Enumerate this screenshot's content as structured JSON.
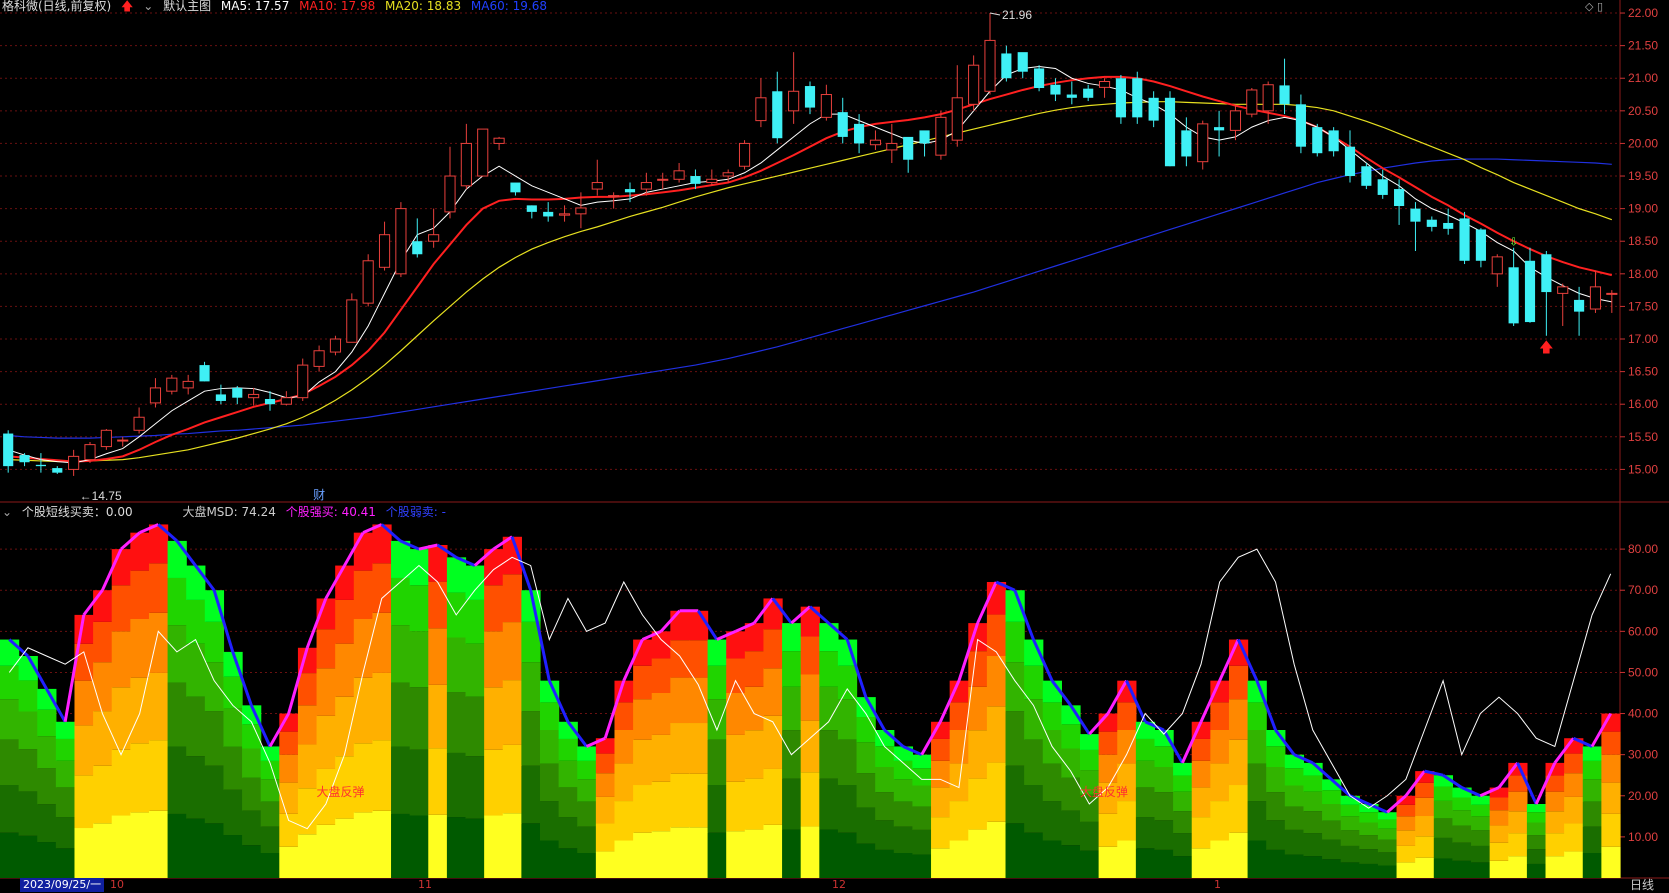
{
  "main_header": {
    "stock": "格科微(日线,前复权)",
    "template": "默认主图",
    "ma5": "MA5: 17.57",
    "ma10": "MA10: 17.98",
    "ma20": "MA20: 18.83",
    "ma60": "MA60: 19.68"
  },
  "sub_header": {
    "indicator": "个股短线买卖：0.00",
    "msd": "大盘MSD: 74.24",
    "strong_buy": "个股强买: 40.41",
    "strong_sell": "个股弱卖: -"
  },
  "annotations": {
    "high_label": "21.96",
    "low_label": "14.75",
    "finance_mark": "财",
    "rebound_1": "大盘反弹",
    "rebound_2": "大盘反弹"
  },
  "bottom_axis": {
    "date_box": "2023/09/25/一",
    "month_0": "10",
    "month_1": "11",
    "month_2": "12",
    "month_3": "1",
    "period_button": "日线"
  },
  "colors": {
    "up": "#e8403c",
    "down": "#3ff0f5",
    "ma5": "#ffffff",
    "ma10": "#ff2020",
    "ma20": "#e6e020",
    "ma60": "#2030e0",
    "grid": "#6a1010",
    "buy_line": "#ff20ff",
    "sell_line": "#2020ff"
  },
  "chart_data": [
    {
      "type": "candlestick",
      "title": "格科微(日线,前复权)",
      "ylim": [
        14.5,
        22.2
      ],
      "y_ticks": [
        "22.00",
        "21.50",
        "21.00",
        "20.50",
        "20.00",
        "19.50",
        "19.00",
        "18.50",
        "18.00",
        "17.50",
        "17.00",
        "16.50",
        "16.00",
        "15.50",
        "15.00"
      ],
      "open": [
        15.55,
        15.22,
        15.07,
        15.02,
        15.0,
        15.15,
        15.35,
        15.45,
        15.6,
        16.02,
        16.2,
        16.25,
        16.6,
        16.15,
        16.25,
        16.1,
        16.08,
        16.0,
        16.1,
        16.58,
        16.8,
        16.95,
        17.55,
        18.1,
        18.0,
        18.5,
        18.5,
        18.95,
        19.35,
        19.5,
        20.0,
        19.4,
        19.05,
        18.95,
        18.9,
        18.92,
        19.3,
        19.2,
        19.3,
        19.3,
        19.45,
        19.45,
        19.5,
        19.4,
        19.5,
        19.65,
        20.35,
        20.8,
        20.5,
        20.88,
        20.4,
        20.48,
        20.3,
        19.98,
        19.9,
        20.1,
        20.2,
        19.82,
        20.05,
        20.6,
        20.8,
        21.38,
        21.4,
        21.15,
        20.9,
        20.75,
        20.84,
        20.86,
        21.0,
        21.0,
        20.7,
        20.7,
        20.2,
        19.72,
        20.25,
        20.2,
        20.45,
        20.5,
        20.89,
        20.6,
        20.25,
        20.2,
        19.95,
        19.65,
        19.45,
        19.3,
        19.0,
        18.83,
        18.78,
        18.85,
        18.68,
        18.0,
        18.1,
        18.2,
        18.3,
        17.7,
        17.6,
        17.46,
        17.7
      ],
      "close": [
        15.05,
        15.11,
        15.05,
        14.95,
        15.2,
        15.38,
        15.6,
        15.45,
        15.8,
        16.25,
        16.4,
        16.35,
        16.35,
        16.05,
        16.1,
        16.15,
        16.0,
        16.1,
        16.6,
        16.82,
        17.0,
        17.6,
        18.2,
        18.6,
        19.0,
        18.3,
        18.6,
        19.5,
        20.0,
        20.22,
        20.08,
        19.25,
        18.95,
        18.88,
        18.92,
        19.01,
        19.4,
        19.2,
        19.25,
        19.4,
        19.45,
        19.58,
        19.38,
        19.45,
        19.55,
        20.0,
        20.7,
        20.08,
        20.8,
        20.55,
        20.75,
        20.1,
        20.0,
        20.05,
        20.0,
        19.75,
        20.0,
        20.4,
        20.7,
        21.2,
        21.58,
        21.0,
        21.1,
        20.85,
        20.75,
        20.7,
        20.7,
        20.95,
        20.4,
        20.4,
        20.35,
        19.65,
        19.8,
        20.3,
        20.2,
        20.5,
        20.82,
        20.9,
        20.6,
        19.95,
        19.85,
        19.88,
        19.5,
        19.35,
        19.21,
        19.04,
        18.8,
        18.72,
        18.69,
        18.2,
        18.2,
        18.26,
        17.24,
        17.26,
        17.72,
        17.8,
        17.42,
        17.8,
        17.7
      ],
      "high": [
        15.6,
        15.25,
        15.25,
        15.05,
        15.3,
        15.42,
        15.62,
        15.5,
        15.95,
        16.4,
        16.45,
        16.45,
        16.65,
        16.3,
        16.28,
        16.25,
        16.2,
        16.2,
        16.7,
        16.9,
        17.05,
        17.7,
        18.3,
        18.8,
        19.1,
        18.85,
        19.0,
        19.95,
        20.3,
        20.1,
        20.1,
        19.35,
        19.05,
        19.1,
        19.05,
        19.25,
        19.75,
        19.25,
        19.4,
        19.55,
        19.55,
        19.7,
        19.6,
        19.6,
        19.6,
        20.05,
        21.0,
        21.1,
        21.4,
        20.95,
        20.9,
        20.7,
        20.45,
        20.2,
        20.3,
        20.05,
        20.05,
        20.5,
        21.2,
        21.35,
        22.0,
        21.5,
        21.35,
        21.2,
        21.0,
        20.95,
        20.9,
        21.0,
        21.05,
        21.1,
        20.8,
        20.8,
        20.4,
        20.35,
        20.5,
        20.6,
        20.85,
        20.95,
        21.3,
        20.75,
        20.3,
        20.25,
        20.2,
        19.7,
        19.6,
        19.45,
        19.1,
        18.88,
        19.0,
        18.95,
        18.7,
        18.3,
        18.4,
        18.4,
        18.35,
        17.85,
        17.8,
        18.05,
        17.75
      ],
      "low": [
        14.95,
        15.05,
        14.95,
        14.93,
        14.9,
        15.1,
        15.3,
        15.35,
        15.55,
        15.95,
        16.15,
        16.15,
        16.35,
        16.0,
        16.0,
        15.98,
        15.9,
        15.98,
        16.05,
        16.5,
        16.75,
        16.95,
        17.5,
        18.05,
        17.95,
        18.25,
        18.4,
        18.85,
        19.3,
        19.8,
        19.9,
        19.2,
        18.85,
        18.8,
        18.8,
        18.7,
        19.2,
        19.0,
        19.1,
        19.2,
        19.3,
        19.4,
        19.3,
        19.35,
        19.4,
        19.6,
        20.25,
        20.0,
        20.3,
        20.45,
        20.35,
        20.0,
        19.85,
        19.9,
        19.7,
        19.55,
        19.8,
        19.75,
        19.95,
        20.5,
        20.75,
        20.95,
        21.0,
        20.8,
        20.65,
        20.6,
        20.65,
        20.7,
        20.3,
        20.3,
        20.25,
        19.65,
        19.65,
        19.6,
        19.8,
        20.05,
        20.4,
        20.3,
        20.45,
        19.85,
        19.8,
        19.8,
        19.4,
        19.3,
        19.15,
        18.75,
        18.35,
        18.65,
        18.6,
        18.15,
        18.1,
        17.8,
        17.2,
        17.25,
        17.05,
        17.2,
        17.05,
        17.4,
        17.4
      ],
      "ma5": [
        15.3,
        15.22,
        15.15,
        15.12,
        15.1,
        15.15,
        15.24,
        15.32,
        15.5,
        15.7,
        15.9,
        16.05,
        16.2,
        16.24,
        16.25,
        16.24,
        16.18,
        16.1,
        16.12,
        16.34,
        16.5,
        16.8,
        17.2,
        17.7,
        18.2,
        18.6,
        18.7,
        18.95,
        19.3,
        19.5,
        19.65,
        19.5,
        19.35,
        19.25,
        19.15,
        19.05,
        19.1,
        19.12,
        19.15,
        19.25,
        19.3,
        19.35,
        19.4,
        19.42,
        19.45,
        19.55,
        19.7,
        19.9,
        20.1,
        20.3,
        20.45,
        20.45,
        20.35,
        20.25,
        20.15,
        20.05,
        20.0,
        20.05,
        20.2,
        20.5,
        20.8,
        21.05,
        21.15,
        21.18,
        21.15,
        21.0,
        20.92,
        20.88,
        20.82,
        20.7,
        20.6,
        20.45,
        20.25,
        20.1,
        20.05,
        20.1,
        20.25,
        20.35,
        20.4,
        20.35,
        20.25,
        20.1,
        19.9,
        19.7,
        19.5,
        19.35,
        19.15,
        19.0,
        18.9,
        18.78,
        18.65,
        18.48,
        18.35,
        18.1,
        17.95,
        17.82,
        17.7,
        17.62,
        17.57
      ],
      "ma10": [
        15.2,
        15.18,
        15.16,
        15.14,
        15.12,
        15.13,
        15.16,
        15.2,
        15.3,
        15.42,
        15.53,
        15.62,
        15.72,
        15.8,
        15.88,
        15.96,
        16.02,
        16.08,
        16.15,
        16.28,
        16.42,
        16.6,
        16.82,
        17.1,
        17.45,
        17.8,
        18.15,
        18.45,
        18.75,
        19.0,
        19.12,
        19.15,
        19.14,
        19.14,
        19.15,
        19.17,
        19.18,
        19.18,
        19.2,
        19.22,
        19.25,
        19.28,
        19.32,
        19.36,
        19.4,
        19.48,
        19.58,
        19.7,
        19.82,
        19.95,
        20.08,
        20.18,
        20.25,
        20.3,
        20.33,
        20.36,
        20.4,
        20.45,
        20.52,
        20.6,
        20.68,
        20.75,
        20.82,
        20.88,
        20.93,
        20.97,
        21.0,
        21.02,
        21.02,
        21.0,
        20.95,
        20.88,
        20.8,
        20.72,
        20.65,
        20.58,
        20.52,
        20.47,
        20.42,
        20.35,
        20.25,
        20.1,
        19.95,
        19.78,
        19.62,
        19.48,
        19.33,
        19.18,
        19.05,
        18.9,
        18.77,
        18.63,
        18.5,
        18.38,
        18.27,
        18.18,
        18.1,
        18.04,
        17.98
      ],
      "ma20": [
        15.15,
        15.14,
        15.13,
        15.12,
        15.12,
        15.13,
        15.14,
        15.15,
        15.18,
        15.22,
        15.26,
        15.3,
        15.36,
        15.42,
        15.48,
        15.55,
        15.62,
        15.7,
        15.8,
        15.92,
        16.06,
        16.22,
        16.4,
        16.6,
        16.82,
        17.05,
        17.28,
        17.5,
        17.72,
        17.92,
        18.1,
        18.25,
        18.38,
        18.48,
        18.57,
        18.65,
        18.72,
        18.8,
        18.88,
        18.95,
        19.02,
        19.1,
        19.18,
        19.25,
        19.32,
        19.38,
        19.44,
        19.5,
        19.56,
        19.62,
        19.68,
        19.74,
        19.8,
        19.86,
        19.92,
        19.98,
        20.04,
        20.1,
        20.16,
        20.22,
        20.28,
        20.34,
        20.4,
        20.46,
        20.51,
        20.55,
        20.58,
        20.6,
        20.62,
        20.63,
        20.64,
        20.64,
        20.63,
        20.62,
        20.61,
        20.6,
        20.6,
        20.6,
        20.6,
        20.58,
        20.55,
        20.5,
        20.42,
        20.34,
        20.25,
        20.15,
        20.05,
        19.95,
        19.85,
        19.75,
        19.63,
        19.52,
        19.4,
        19.3,
        19.2,
        19.1,
        19.0,
        18.92,
        18.83
      ],
      "ma60": [
        15.52,
        15.5,
        15.49,
        15.48,
        15.48,
        15.48,
        15.49,
        15.5,
        15.51,
        15.52,
        15.54,
        15.55,
        15.57,
        15.59,
        15.6,
        15.62,
        15.64,
        15.66,
        15.68,
        15.71,
        15.74,
        15.77,
        15.8,
        15.84,
        15.88,
        15.92,
        15.96,
        16.0,
        16.04,
        16.08,
        16.12,
        16.16,
        16.2,
        16.24,
        16.28,
        16.32,
        16.36,
        16.4,
        16.44,
        16.48,
        16.52,
        16.56,
        16.6,
        16.65,
        16.7,
        16.76,
        16.82,
        16.88,
        16.95,
        17.02,
        17.09,
        17.16,
        17.23,
        17.3,
        17.37,
        17.44,
        17.51,
        17.58,
        17.65,
        17.72,
        17.8,
        17.88,
        17.96,
        18.04,
        18.12,
        18.2,
        18.28,
        18.36,
        18.44,
        18.52,
        18.6,
        18.68,
        18.76,
        18.84,
        18.92,
        19.0,
        19.08,
        19.16,
        19.24,
        19.32,
        19.4,
        19.46,
        19.52,
        19.57,
        19.62,
        19.66,
        19.7,
        19.73,
        19.75,
        19.76,
        19.76,
        19.76,
        19.75,
        19.74,
        19.73,
        19.72,
        19.71,
        19.7,
        19.68
      ]
    },
    {
      "type": "area",
      "title": "个股短线买卖",
      "ylim": [
        0,
        90
      ],
      "y_ticks": [
        "80.00",
        "70.00",
        "60.00",
        "50.00",
        "40.00",
        "30.00",
        "20.00",
        "10.00"
      ],
      "stock_strength": [
        58,
        54,
        46,
        38,
        64,
        70,
        80,
        84,
        86,
        82,
        76,
        70,
        55,
        42,
        32,
        40,
        56,
        68,
        76,
        84,
        86,
        82,
        80,
        81,
        78,
        76,
        80,
        83,
        70,
        48,
        38,
        32,
        34,
        48,
        58,
        60,
        65,
        65,
        58,
        60,
        62,
        68,
        62,
        66,
        62,
        58,
        44,
        36,
        32,
        30,
        38,
        48,
        62,
        72,
        70,
        58,
        48,
        42,
        35,
        40,
        48,
        38,
        36,
        28,
        38,
        48,
        58,
        48,
        36,
        30,
        28,
        24,
        20,
        18,
        16,
        20,
        26,
        25,
        22,
        20,
        22,
        28,
        18,
        28,
        34,
        32,
        40
      ],
      "white_line": [
        50,
        56,
        54,
        52,
        55,
        40,
        30,
        40,
        60,
        55,
        58,
        48,
        42,
        38,
        28,
        14,
        12,
        18,
        30,
        50,
        68,
        72,
        76,
        72,
        64,
        70,
        75,
        78,
        76,
        58,
        68,
        60,
        62,
        72,
        64,
        58,
        54,
        47,
        36,
        48,
        40,
        38,
        30,
        34,
        38,
        46,
        40,
        32,
        28,
        24,
        24,
        22,
        58,
        55,
        48,
        42,
        32,
        26,
        18,
        22,
        30,
        40,
        35,
        40,
        52,
        72,
        78,
        80,
        72,
        52,
        36,
        28,
        20,
        17,
        20,
        24,
        36,
        48,
        30,
        40,
        44,
        40,
        34,
        32,
        48,
        64,
        74
      ]
    }
  ]
}
